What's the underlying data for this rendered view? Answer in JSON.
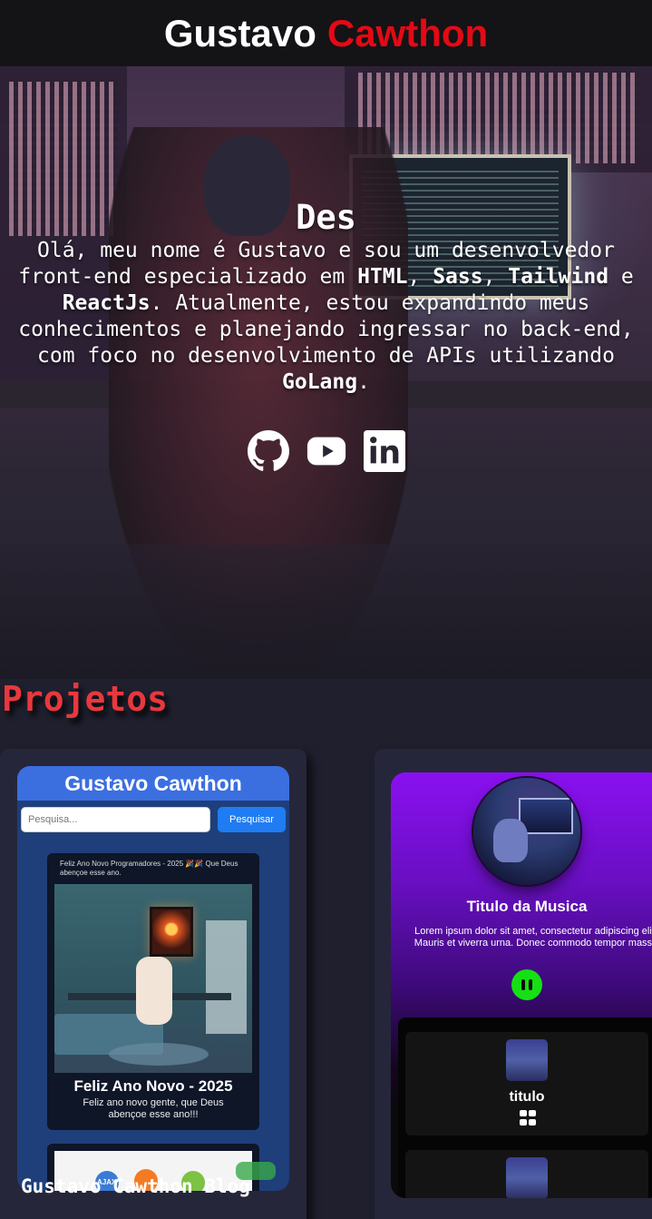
{
  "header": {
    "first_name": "Gustavo",
    "last_name": "Cawthon"
  },
  "hero": {
    "typed_text": "Des",
    "bio_intro": "Olá, meu nome é Gustavo e sou um desenvolvedor front-end especializado em ",
    "skill_html": "HTML",
    "sep1": ", ",
    "skill_sass": "Sass",
    "sep2": ", ",
    "skill_tailwind": "Tailwind",
    "sep3": " e ",
    "skill_react": "ReactJs",
    "bio_middle": ". Atualmente, estou expandindo meus conhecimentos e planejando ingressar no back-end, com foco no desenvolvimento de APIs utilizando ",
    "skill_go": "GoLang",
    "bio_end": "."
  },
  "socials": [
    {
      "icon": "github-icon"
    },
    {
      "icon": "youtube-icon"
    },
    {
      "icon": "linkedin-icon"
    }
  ],
  "projects": {
    "title": "Projetos",
    "blog": {
      "header_title": "Gustavo Cawthon",
      "search_placeholder": "Pesquisa...",
      "search_button": "Pesquisar",
      "post1_caption": "Feliz Ano Novo Programadores - 2025 🎉🎉 Que Deus abençoe esse ano.",
      "post1_title": "Feliz Ano Novo - 2025",
      "post1_description": "Feliz ano novo gente, que Deus abençoe esse ano!!!",
      "post2_badge": "AJAX",
      "project_label": "Gustavo Cawthon Blog"
    },
    "music": {
      "track_title": "Titulo da Musica",
      "description": "Lorem ipsum dolor sit amet, consectetur adipiscing elit. Mauris et viverra urna. Donec commodo tempor massa",
      "playlist": [
        {
          "name": "titulo"
        },
        {
          "name": ""
        }
      ],
      "accent_color": "#15e014"
    }
  },
  "colors": {
    "accent_red": "#e50914",
    "section_title": "#e8383d",
    "blog_header": "#3b6fe0",
    "music_purple": "#8a10f0"
  }
}
